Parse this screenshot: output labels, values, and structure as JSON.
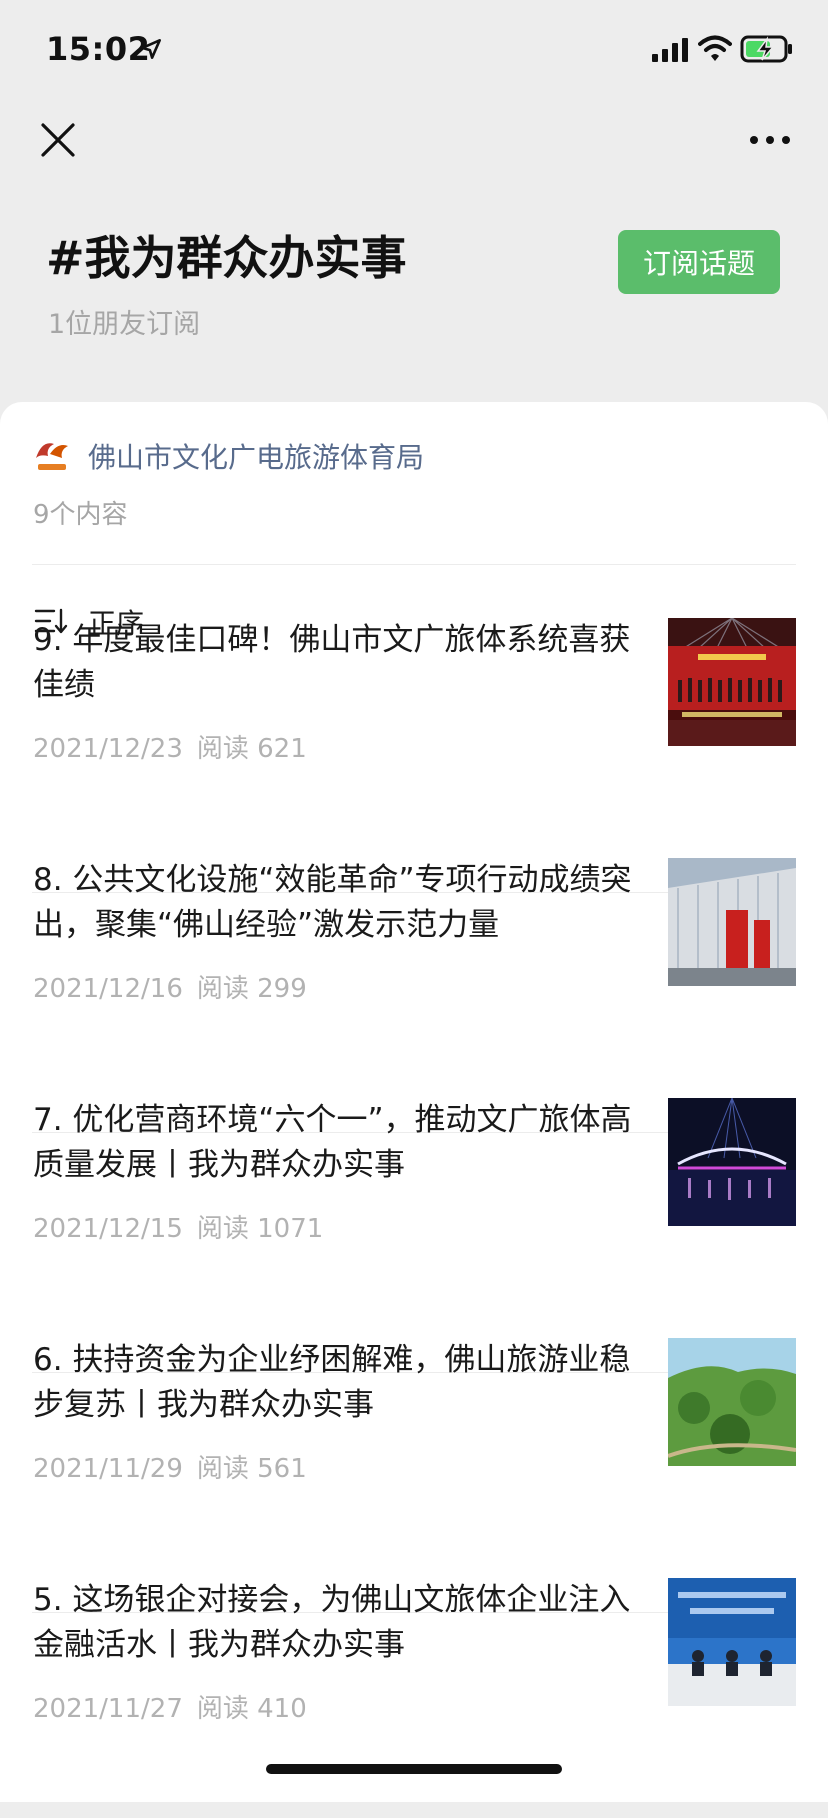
{
  "status_bar": {
    "time": "15:02"
  },
  "header": {
    "topic": "#我为群众办实事",
    "subscribers": "1位朋友订阅",
    "subscribe_label": "订阅话题"
  },
  "account": {
    "name": "佛山市文化广电旅游体育局",
    "count": "9个内容"
  },
  "sort": {
    "label": "正序"
  },
  "articles": [
    {
      "title": "9. 年度最佳口碑！佛山市文广旅体系统喜获佳绩",
      "date": "2021/12/23",
      "reads": "阅读 621"
    },
    {
      "title": "8. 公共文化设施“效能革命”专项行动成绩突出，聚集“佛山经验”激发示范力量",
      "date": "2021/12/16",
      "reads": "阅读 299"
    },
    {
      "title": "7. 优化营商环境“六个一”，推动文广旅体高质量发展丨我为群众办实事",
      "date": "2021/12/15",
      "reads": "阅读 1071"
    },
    {
      "title": "6. 扶持资金为企业纾困解难，佛山旅游业稳步复苏丨我为群众办实事",
      "date": "2021/11/29",
      "reads": "阅读 561"
    },
    {
      "title": "5. 这场银企对接会，为佛山文旅体企业注入金融活水丨我为群众办实事",
      "date": "2021/11/27",
      "reads": "阅读 410"
    }
  ],
  "colors": {
    "accent": "#5bbd6b",
    "author_link": "#586b8c",
    "meta": "#b2b2b2"
  }
}
